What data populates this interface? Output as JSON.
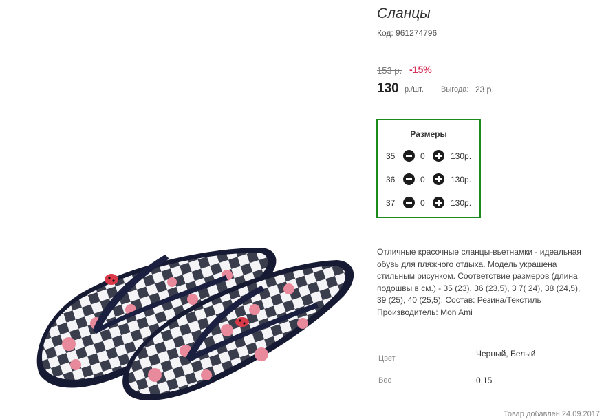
{
  "product": {
    "title": "Сланцы",
    "code": "Код: 961274796",
    "old_price": "153 р.",
    "discount": "-15%",
    "price": "130",
    "unit": "р./шт.",
    "savings_label": "Выгода:",
    "savings_value": "23 р.",
    "image_icon": "flip-flops-photo"
  },
  "sizes": {
    "title": "Размеры",
    "rows": [
      {
        "size": "35",
        "qty": "0",
        "price": "130р."
      },
      {
        "size": "36",
        "qty": "0",
        "price": "130р."
      },
      {
        "size": "37",
        "qty": "0",
        "price": "130р."
      }
    ],
    "accent_color": "#1a8a1a"
  },
  "description": "Отличные красочные сланцы-вьетнамки - идеальная обувь для пляжного отдыха. Модель украшена стильным рисунком. Соответствие размеров (длина подошвы в см.) - 35 (23), 36 (23,5), 3 7( 24), 38 (24,5), 39 (25), 40 (25,5). Состав: Резина/Текстиль Производитель: Mon Ami",
  "attributes": [
    {
      "label": "Цвет",
      "value": "Черный, Белый"
    },
    {
      "label": "Вес",
      "value": "0,15"
    }
  ],
  "added_text": "Товар добавлен 24.09.2017",
  "colors": {
    "discount": "#d7345c",
    "sole": "#1b1f3a",
    "pattern_pink": "#e8899c"
  }
}
